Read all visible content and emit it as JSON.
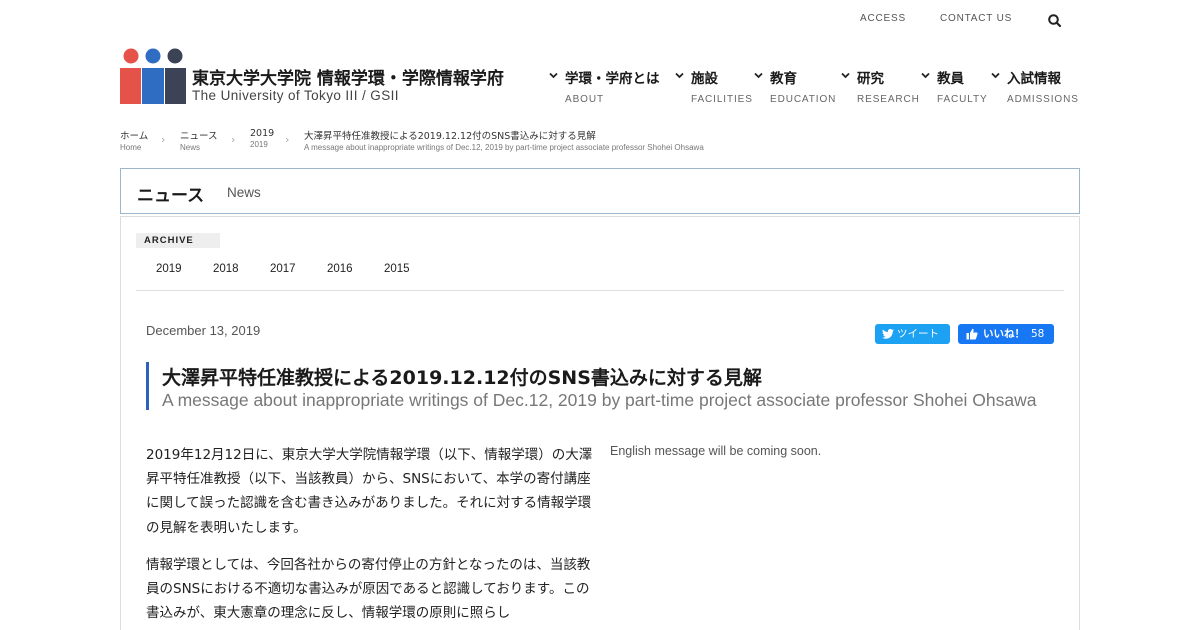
{
  "utility": {
    "access": "ACCESS",
    "contact": "CONTACT US"
  },
  "site": {
    "title": "東京大学大学院 情報学環・学際情報学府",
    "subtitle": "The University of Tokyo III / GSII"
  },
  "logo": {
    "colors": [
      "#e4524a",
      "#2f6dc2",
      "#3d4356"
    ]
  },
  "nav": [
    {
      "jp": "学環・学府とは",
      "en": "ABOUT"
    },
    {
      "jp": "施設",
      "en": "FACILITIES"
    },
    {
      "jp": "教育",
      "en": "EDUCATION"
    },
    {
      "jp": "研究",
      "en": "RESEARCH"
    },
    {
      "jp": "教員",
      "en": "FACULTY"
    },
    {
      "jp": "入試情報",
      "en": "ADMISSIONS"
    }
  ],
  "breadcrumb": [
    {
      "jp": "ホーム",
      "en": "Home"
    },
    {
      "jp": "ニュース",
      "en": "News"
    },
    {
      "jp": "2019",
      "en": "2019"
    },
    {
      "jp": "大澤昇平特任准教授による2019.12.12付のSNS書込みに対する見解",
      "en": "A message about inappropriate writings of Dec.12, 2019 by part-time project associate professor Shohei Ohsawa"
    }
  ],
  "section": {
    "jp": "ニュース",
    "en": "News"
  },
  "archive": {
    "label": "ARCHIVE",
    "years": [
      "2019",
      "2018",
      "2017",
      "2016",
      "2015"
    ]
  },
  "post": {
    "date": "December 13, 2019",
    "title": "大澤昇平特任准教授による2019.12.12付のSNS書込みに対する見解",
    "subtitle": "A message about inappropriate writings of Dec.12, 2019 by part-time project associate professor Shohei Ohsawa",
    "tweet_label": "ツイート",
    "like_label": "いいね！",
    "like_count": "58",
    "body_jp": [
      "2019年12月12日に、東京大学大学院情報学環（以下、情報学環）の大澤昇平特任准教授（以下、当該教員）から、SNSにおいて、本学の寄付講座に関して誤った認識を含む書き込みがありました。それに対する情報学環の見解を表明いたします。",
      "情報学環としては、今回各社からの寄付停止の方針となったのは、当該教員のSNSにおける不適切な書込みが原因であると認識しております。この書込みが、東大憲章の理念に反し、情報学環の原則に照らし"
    ],
    "body_en": "English message will be coming soon."
  },
  "colors": {
    "twitter": "#1da1f2",
    "facebook": "#1877f2",
    "accent": "#2a64b8",
    "header_border": "#9bb7cf"
  }
}
